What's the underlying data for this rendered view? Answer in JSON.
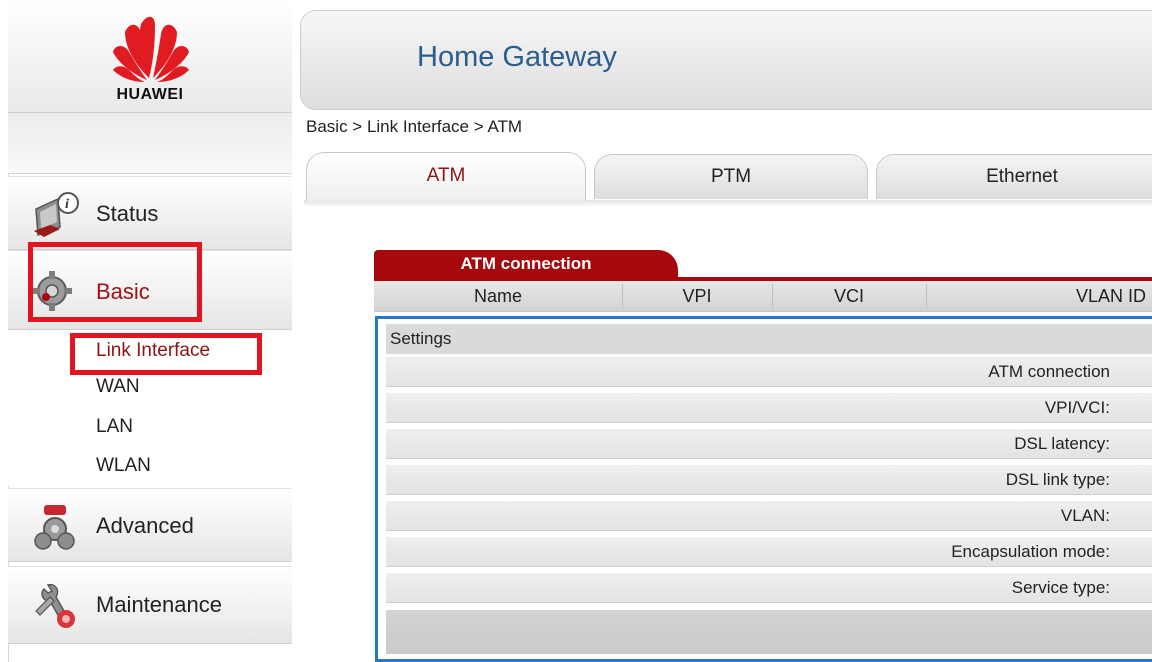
{
  "sidebar": {
    "brand": "HUAWEI",
    "nav": {
      "status": "Status",
      "basic": "Basic",
      "advanced": "Advanced",
      "maintenance": "Maintenance"
    },
    "basic_sub": [
      "Link Interface",
      "WAN",
      "LAN",
      "WLAN"
    ],
    "highlight_color": "#e2141e"
  },
  "header": {
    "title": "Home Gateway"
  },
  "breadcrumb": "Basic > Link Interface > ATM",
  "tabs": [
    {
      "label": "ATM",
      "active": true
    },
    {
      "label": "PTM",
      "active": false
    },
    {
      "label": "Ethernet",
      "active": false
    }
  ],
  "connection": {
    "tab_label": "ATM connection",
    "columns": [
      "Name",
      "VPI",
      "VCI",
      "VLAN ID"
    ],
    "settings_title": "Settings",
    "fields": [
      "ATM connection",
      "VPI/VCI:",
      "DSL latency:",
      "DSL link type:",
      "VLAN:",
      "Encapsulation mode:",
      "Service type:"
    ]
  },
  "colors": {
    "accent_red": "#a5080d",
    "title_blue": "#2b5d8f",
    "box_blue": "#2a77c4",
    "active_text": "#8c1414"
  },
  "icons": [
    "huawei-logo",
    "status-icon",
    "basic-gear-icon",
    "advanced-icon",
    "maintenance-icon"
  ]
}
